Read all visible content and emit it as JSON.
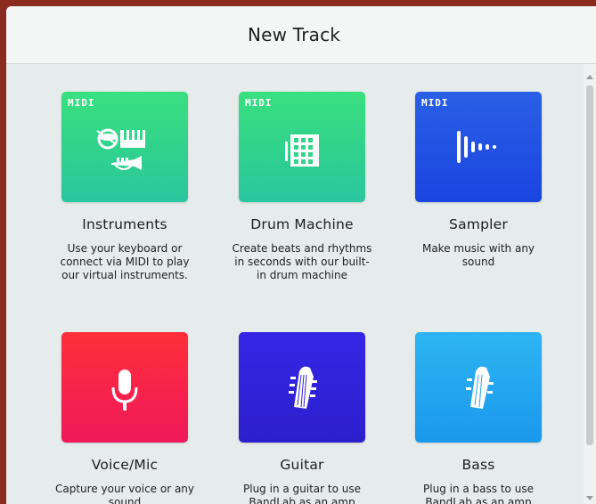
{
  "dialog": {
    "title": "New Track"
  },
  "badge": "MIDI",
  "tracks": [
    {
      "title": "Instruments",
      "description": "Use your keyboard or connect via MIDI to play our virtual instruments.",
      "icon": "instruments-icon",
      "color": "#33d58a",
      "midi": true
    },
    {
      "title": "Drum Machine",
      "description": "Create beats and rhythms in seconds with our built-in drum machine",
      "icon": "drum-pad-icon",
      "color": "#33d58a",
      "midi": true
    },
    {
      "title": "Sampler",
      "description": "Make music with any sound",
      "icon": "waveform-icon",
      "color": "#1f4de2",
      "midi": true
    },
    {
      "title": "Voice/Mic",
      "description": "Capture your voice or any sound",
      "icon": "microphone-icon",
      "color": "#f72347",
      "midi": false
    },
    {
      "title": "Guitar",
      "description": "Plug in a guitar to use BandLab as an amp",
      "icon": "guitar-headstock-icon",
      "color": "#3123d8",
      "midi": false
    },
    {
      "title": "Bass",
      "description": "Plug in a bass to use BandLab as an amp",
      "icon": "bass-headstock-icon",
      "color": "#22a7ef",
      "midi": false
    }
  ]
}
